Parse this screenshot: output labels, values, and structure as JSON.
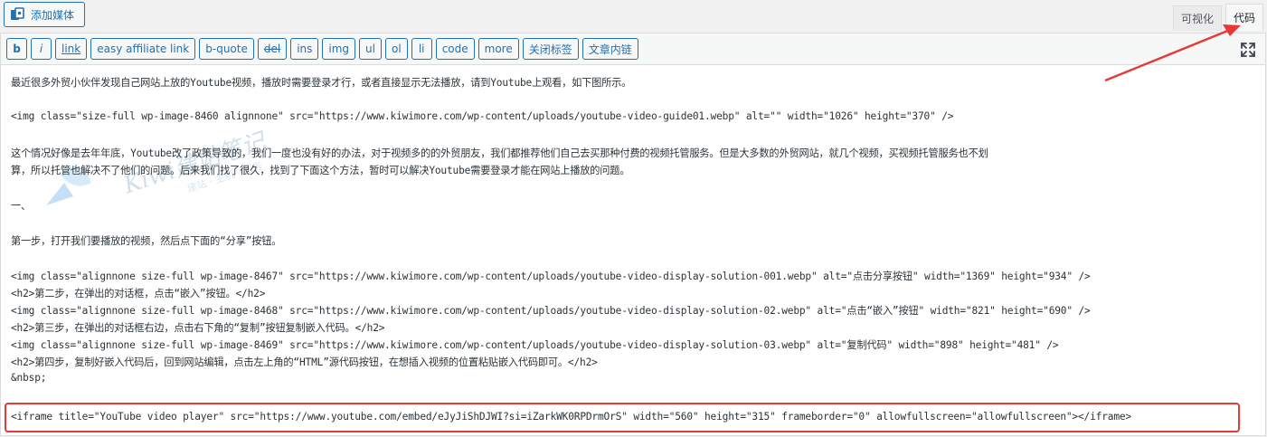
{
  "toolbar": {
    "add_media_label": "添加媒体",
    "tabs": {
      "visual": "可视化",
      "code": "代码"
    }
  },
  "quicktags": [
    {
      "label": "b",
      "name": "qt-b-button",
      "style": "bold"
    },
    {
      "label": "i",
      "name": "qt-i-button",
      "style": "italic"
    },
    {
      "label": "link",
      "name": "qt-link-button",
      "style": "link"
    },
    {
      "label": "easy affiliate link",
      "name": "qt-easy-affiliate-link-button",
      "style": ""
    },
    {
      "label": "b-quote",
      "name": "qt-b-quote-button",
      "style": ""
    },
    {
      "label": "del",
      "name": "qt-del-button",
      "style": "strike"
    },
    {
      "label": "ins",
      "name": "qt-ins-button",
      "style": ""
    },
    {
      "label": "img",
      "name": "qt-img-button",
      "style": ""
    },
    {
      "label": "ul",
      "name": "qt-ul-button",
      "style": ""
    },
    {
      "label": "ol",
      "name": "qt-ol-button",
      "style": ""
    },
    {
      "label": "li",
      "name": "qt-li-button",
      "style": ""
    },
    {
      "label": "code",
      "name": "qt-code-button",
      "style": ""
    },
    {
      "label": "more",
      "name": "qt-more-button",
      "style": ""
    },
    {
      "label": "关闭标签",
      "name": "qt-close-tags-button",
      "style": ""
    },
    {
      "label": "文章内链",
      "name": "qt-internal-link-button",
      "style": ""
    }
  ],
  "watermark": {
    "text": "Kiwi建站笔记",
    "subtext": "建站 · 主机 · 服务"
  },
  "content": {
    "lines": [
      "最近很多外贸小伙伴发现自己网站上放的Youtube视频，播放时需要登录才行，或者直接显示无法播放，请到Youtube上观看，如下图所示。",
      "<img class=\"size-full wp-image-8460 alignnone\" src=\"https://www.kiwimore.com/wp-content/uploads/youtube-video-guide01.webp\" alt=\"\" width=\"1026\" height=\"370\" />",
      "这个情况好像是去年年底，Youtube改了政策导致的，我们一度也没有好的办法，对于视频多的的外贸朋友，我们都推荐他们自己去买那种付费的视频托管服务。但是大多数的外贸网站，就几个视频，买视频托管服务也不划",
      "算，所以托管也解决不了他们的问题。后来我们找了很久，找到了下面这个方法，暂时可以解决Youtube需要登录才能在网站上播放的问题。",
      "一、",
      "第一步，打开我们要播放的视频，然后点下面的“分享”按钮。",
      "<img class=\"alignnone size-full wp-image-8467\" src=\"https://www.kiwimore.com/wp-content/uploads/youtube-video-display-solution-001.webp\" alt=\"点击分享按钮\" width=\"1369\" height=\"934\" />",
      "<h2>第二步，在弹出的对话框，点击“嵌入”按钮。</h2>",
      "<img class=\"alignnone size-full wp-image-8468\" src=\"https://www.kiwimore.com/wp-content/uploads/youtube-video-display-solution-02.webp\" alt=\"点击“嵌入”按钮\" width=\"821\" height=\"690\" />",
      "<h2>第三步，在弹出的对话框右边，点击右下角的“复制”按钮复制嵌入代码。</h2>",
      "<img class=\"alignnone size-full wp-image-8469\" src=\"https://www.kiwimore.com/wp-content/uploads/youtube-video-display-solution-03.webp\" alt=\"复制代码\" width=\"898\" height=\"481\" />",
      "<h2>第四步，复制好嵌入代码后，回到网站编辑，点击左上角的“HTML”源代码按钮，在想插入视频的位置粘贴嵌入代码即可。</h2>",
      "&nbsp;",
      "<iframe title=\"YouTube video player\" src=\"https://www.youtube.com/embed/eJyJiShDJWI?si=iZarkWK0RPDrmOrS\" width=\"560\" height=\"315\" frameborder=\"0\" allowfullscreen=\"allowfullscreen\"></iframe>"
    ]
  },
  "colors": {
    "accent": "#2271b1",
    "annotation_red": "#e53935",
    "text": "#2c3338"
  }
}
